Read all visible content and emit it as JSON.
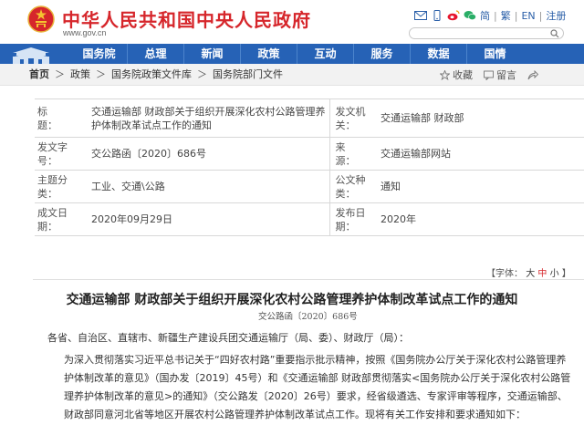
{
  "header": {
    "site_title": "中华人民共和国中央人民政府",
    "site_url": "www.gov.cn",
    "lang_simplified": "简",
    "lang_traditional": "繁",
    "lang_english": "EN",
    "register": "注册",
    "search_placeholder": ""
  },
  "nav": {
    "items": [
      "国务院",
      "总理",
      "新闻",
      "政策",
      "互动",
      "服务",
      "数据",
      "国情"
    ]
  },
  "breadcrumb": {
    "home": "首页",
    "items": [
      "政策",
      "国务院政策文件库",
      "国务院部门文件"
    ],
    "separator": "＞"
  },
  "actions": {
    "favorite": "收藏",
    "print": "留言",
    "share": ""
  },
  "info": {
    "title_label": "标　　题：",
    "title_value": "交通运输部 财政部关于组织开展深化农村公路管理养护体制改革试点工作的通知",
    "issuer_label": "发文机关：",
    "issuer_value": "交通运输部  财政部",
    "docno_label": "发文字号：",
    "docno_value": "交公路函〔2020〕686号",
    "source_label": "来　　源：",
    "source_value": "交通运输部网站",
    "subject_label": "主题分类：",
    "subject_value": "工业、交通\\公路",
    "type_label": "公文种类：",
    "type_value": "通知",
    "written_label": "成文日期：",
    "written_value": "2020年09月29日",
    "published_label": "发布日期：",
    "published_value": "2020年"
  },
  "fontsize": {
    "label": "【字体：",
    "big": "大",
    "mid": "中",
    "small": "小",
    "end": "】"
  },
  "article": {
    "title": "交通运输部  财政部关于组织开展深化农村公路管理养护体制改革试点工作的通知",
    "doc_no": "交公路函〔2020〕686号",
    "salutation": "各省、自治区、直辖市、新疆生产建设兵团交通运输厅（局、委）、财政厅（局）：",
    "body": "为深入贯彻落实习近平总书记关于“四好农村路”重要指示批示精神，按照《国务院办公厅关于深化农村公路管理养护体制改革的意见》（国办发〔2019〕45号）和《交通运输部 财政部贯彻落实<国务院办公厅关于深化农村公路管理养护体制改革的意见>的通知》（交公路发〔2020〕26号）要求，经省级遴选、专家评审等程序，交通运输部、财政部同意河北省等地区开展农村公路管理养护体制改革试点工作。现将有关工作安排和要求通知如下："
  },
  "colors": {
    "brand_red": "#d6262b",
    "nav_blue": "#2662b6",
    "link_blue": "#2a5fa8"
  }
}
